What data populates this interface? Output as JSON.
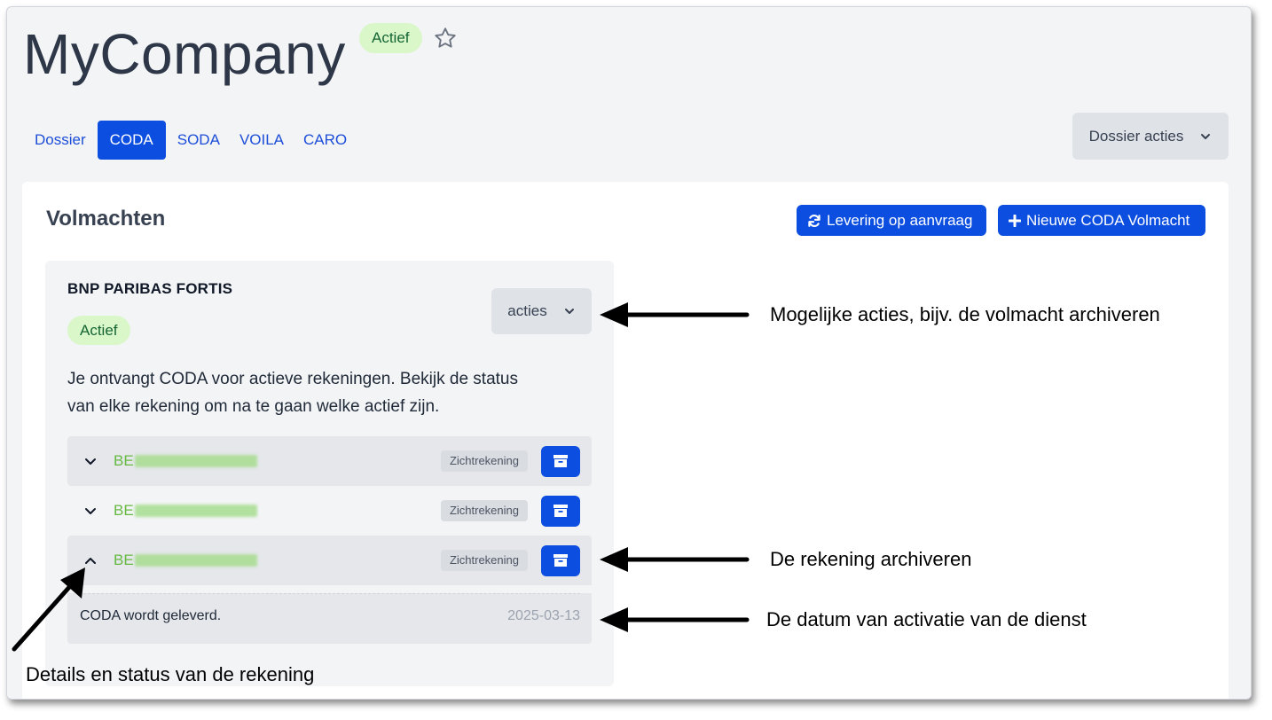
{
  "header": {
    "title": "MyCompany",
    "status_badge": "Actief"
  },
  "tabs": [
    {
      "label": "Dossier",
      "active": false
    },
    {
      "label": "CODA",
      "active": true
    },
    {
      "label": "SODA",
      "active": false
    },
    {
      "label": "VOILA",
      "active": false
    },
    {
      "label": "CARO",
      "active": false
    }
  ],
  "dossier_actions_label": "Dossier acties",
  "panel": {
    "title": "Volmachten",
    "levering_button": "Levering op aanvraag",
    "nieuwe_button": "Nieuwe CODA Volmacht"
  },
  "card": {
    "bank_name": "BNP PARIBAS FORTIS",
    "status_badge": "Actief",
    "acties_label": "acties",
    "description": "Je ontvangt CODA voor actieve rekeningen. Bekijk de status van elke rekening om na te gaan welke actief zijn.",
    "accounts": [
      {
        "iban_prefix": "BE",
        "type": "Zichtrekening",
        "expanded": false
      },
      {
        "iban_prefix": "BE",
        "type": "Zichtrekening",
        "expanded": false
      },
      {
        "iban_prefix": "BE",
        "type": "Zichtrekening",
        "expanded": true
      }
    ],
    "detail": {
      "text": "CODA wordt geleverd.",
      "date": "2025-03-13"
    }
  },
  "annotations": {
    "acties": "Mogelijke acties, bijv. de volmacht archiveren",
    "archiveren": "De rekening archiveren",
    "datum": "De datum van activatie van de dienst",
    "details": "Details en status van de rekening"
  },
  "colors": {
    "primary": "#0b4ee0",
    "active_badge_bg": "#d9f7c9",
    "iban_green": "#65b941"
  },
  "icons": {
    "star": "star-icon",
    "chevron": "chevron-down-icon",
    "refresh": "refresh-icon",
    "plus": "plus-icon",
    "archive": "archive-icon"
  }
}
